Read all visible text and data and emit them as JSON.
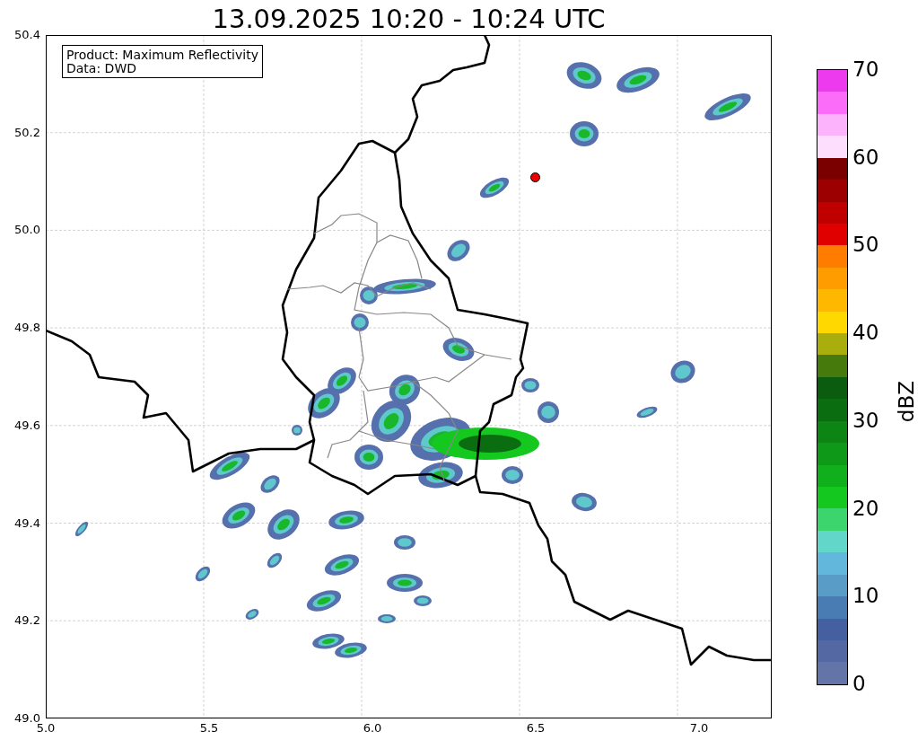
{
  "title": "13.09.2025 10:20 - 10:24 UTC",
  "info_box": [
    "Product: Maximum Reflectivity",
    "Data: DWD"
  ],
  "y_ticks": [
    "50.4",
    "50.2",
    "50.0",
    "49.8",
    "49.6",
    "49.4",
    "49.2",
    "49.0"
  ],
  "x_ticks": [
    "5.0",
    "5.5",
    "6.0",
    "6.5",
    "7.0"
  ],
  "colorbar": {
    "label": "dBZ",
    "ticks": [
      "70",
      "60",
      "50",
      "40",
      "30",
      "20",
      "10",
      "0"
    ],
    "segments": [
      {
        "color": "#6474a8"
      },
      {
        "color": "#5468a4"
      },
      {
        "color": "#4460a0"
      },
      {
        "color": "#4a7cb4"
      },
      {
        "color": "#5a9cc8"
      },
      {
        "color": "#62b8dc"
      },
      {
        "color": "#62d6c8"
      },
      {
        "color": "#3cd46c"
      },
      {
        "color": "#14c820"
      },
      {
        "color": "#10b01c"
      },
      {
        "color": "#0e9a18"
      },
      {
        "color": "#0c8514"
      },
      {
        "color": "#0a6e10"
      },
      {
        "color": "#0b5c0e"
      },
      {
        "color": "#467a0c"
      },
      {
        "color": "#a9ae0c"
      },
      {
        "color": "#ffd800"
      },
      {
        "color": "#ffb800"
      },
      {
        "color": "#ff9c00"
      },
      {
        "color": "#ff7c00"
      },
      {
        "color": "#e00000"
      },
      {
        "color": "#c00000"
      },
      {
        "color": "#9c0000"
      },
      {
        "color": "#7a0000"
      },
      {
        "color": "#fddffd"
      },
      {
        "color": "#fdb3fc"
      },
      {
        "color": "#fb6cf9"
      },
      {
        "color": "#ee3aee"
      }
    ]
  }
}
